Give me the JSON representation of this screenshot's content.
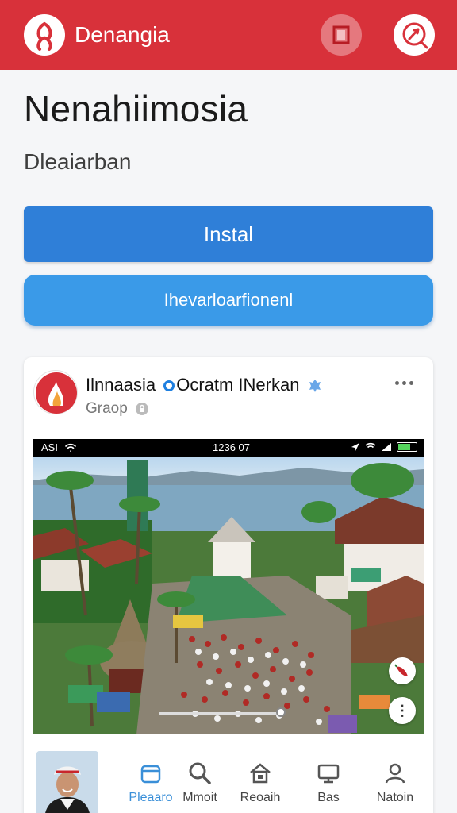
{
  "app": {
    "title": "Denangia",
    "accent_color": "#d8313a",
    "logo_icon": "flower-logo-icon",
    "actions": [
      {
        "name": "square-icon"
      },
      {
        "name": "chat-compass-icon"
      }
    ]
  },
  "page": {
    "title": "Nenahiimosia",
    "subtitle": "Dleaiarban"
  },
  "buttons": {
    "install": "Instal",
    "secondary": "Ihevarloarfionenl"
  },
  "post": {
    "author": "Ilnnaasia",
    "author_tag": "Ocratm INerkan",
    "meta": "Graop",
    "screenshot": {
      "status_left": "ASI",
      "status_time": "1236 07"
    }
  },
  "nav": [
    {
      "label": "Pleaaro",
      "icon": "box-icon",
      "active": true
    },
    {
      "label": "Mmoit",
      "icon": "search-icon",
      "active": false
    },
    {
      "label": "Reoaih",
      "icon": "home-icon",
      "active": false
    },
    {
      "label": "Bas",
      "icon": "monitor-icon",
      "active": false
    },
    {
      "label": "Natoin",
      "icon": "person-icon",
      "active": false
    }
  ]
}
